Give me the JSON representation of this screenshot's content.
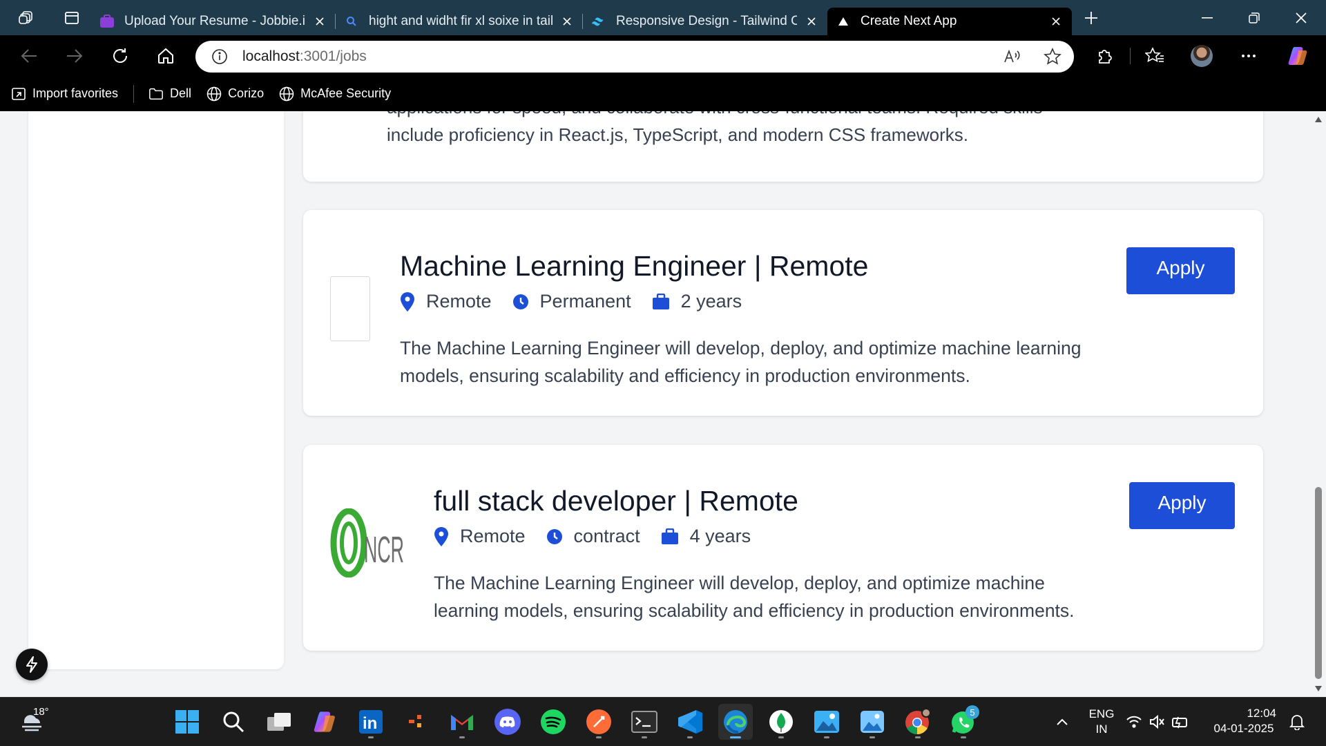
{
  "browser": {
    "tabs": [
      {
        "title": "Upload Your Resume - Jobbie.io",
        "icon": "jobbie-favicon",
        "active": false
      },
      {
        "title": "hight and widht fir xl soixe in tailw",
        "icon": "search-favicon",
        "active": false
      },
      {
        "title": "Responsive Design - Tailwind CSS",
        "icon": "tailwind-favicon",
        "active": false
      },
      {
        "title": "Create Next App",
        "icon": "nextjs-favicon",
        "active": true
      }
    ],
    "url": {
      "host": "localhost",
      "path": ":3001/jobs"
    },
    "bookmarks": [
      {
        "label": "Import favorites",
        "icon": "import-icon"
      },
      {
        "label": "Dell",
        "icon": "folder-icon"
      },
      {
        "label": "Corizo",
        "icon": "globe-icon"
      },
      {
        "label": "McAfee Security",
        "icon": "globe-icon"
      }
    ]
  },
  "page": {
    "previous_card": {
      "description_partial": "applications for speed, and collaborate with cross-functional teams. Required skills",
      "description_last": "include proficiency in React.js, TypeScript, and modern CSS frameworks."
    },
    "jobs": [
      {
        "title": "Machine Learning Engineer | Remote",
        "location": "Remote",
        "type": "Permanent",
        "experience": "2 years",
        "description": "The Machine Learning Engineer will develop, deploy, and optimize machine learning models, ensuring scalability and efficiency in production environments.",
        "apply_label": "Apply",
        "logo": "empty-logo"
      },
      {
        "title": "full stack developer | Remote",
        "location": "Remote",
        "type": "contract",
        "experience": "4 years",
        "description": "The Machine Learning Engineer will develop, deploy, and optimize machine learning models, ensuring scalability and efficiency in production environments.",
        "apply_label": "Apply",
        "logo": "ncr-logo",
        "logo_text": "NCR"
      }
    ],
    "accent_color": "#1d4ed8"
  },
  "taskbar": {
    "weather_temp": "18°",
    "language": {
      "line1": "ENG",
      "line2": "IN"
    },
    "time": "12:04",
    "date": "04-01-2025",
    "whatsapp_badge": "5"
  }
}
